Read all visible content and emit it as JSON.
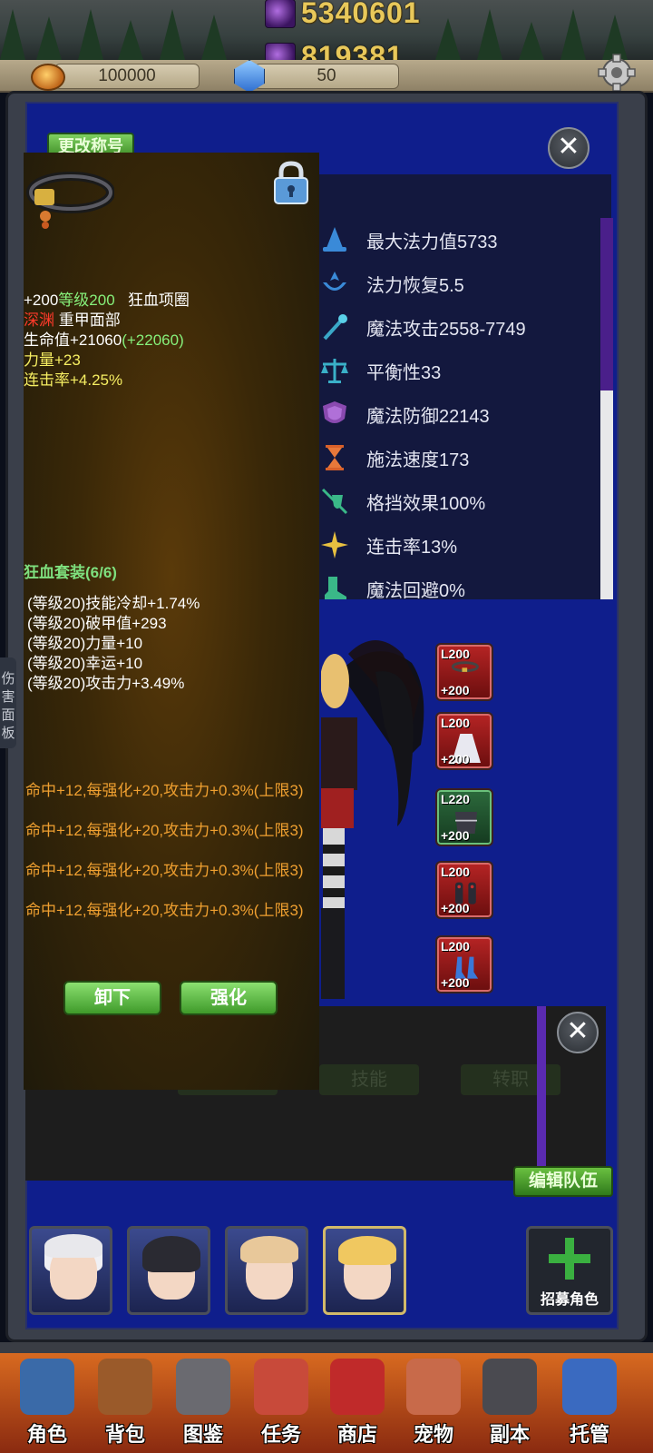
{
  "top": {
    "power_value": "5340601",
    "soul_value": "819381",
    "gold": "100000",
    "gems": "50"
  },
  "panel": {
    "rename_label": "更改称号",
    "close_symbol": "✕"
  },
  "stats": [
    {
      "icon": "wizard-hat-icon",
      "text": "最大法力值5733"
    },
    {
      "icon": "mana-regen-icon",
      "text": "法力恢复5.5"
    },
    {
      "icon": "wand-icon",
      "text": "魔法攻击2558-7749"
    },
    {
      "icon": "scales-icon",
      "text": "平衡性33"
    },
    {
      "icon": "shield-icon",
      "text": "魔法防御22143"
    },
    {
      "icon": "hourglass-icon",
      "text": "施法速度173"
    },
    {
      "icon": "block-icon",
      "text": "格挡效果100%"
    },
    {
      "icon": "combo-star-icon",
      "text": "连击率13%"
    },
    {
      "icon": "dodge-boot-icon",
      "text": "魔法回避0%"
    }
  ],
  "equipment": [
    {
      "level": "L200",
      "plus": "+200"
    },
    {
      "level": "L200",
      "plus": "+200"
    },
    {
      "level": "L220",
      "plus": "+200"
    },
    {
      "level": "L200",
      "plus": "+200"
    },
    {
      "level": "L200",
      "plus": "+200"
    }
  ],
  "side_tab": "伤害面板",
  "lower": {
    "ghost_left": "",
    "ghost_skill": "技能",
    "ghost_rebirth": "转职",
    "edit_team": "编辑队伍"
  },
  "recruit_label": "招募角色",
  "tooltip": {
    "enhance": "+200",
    "level_prefix": "等级",
    "level": "200",
    "item_name": "狂血项圈",
    "quality": "深渊",
    "slot": "重甲面部",
    "hp": "生命值+21060",
    "hp_bonus": "(+22060)",
    "strength": "力量+23",
    "combo": "连击率+4.25%",
    "set_title": "狂血套装(6/6)",
    "set_lines": [
      "(等级20)技能冷却+1.74%",
      "(等级20)破甲值+293",
      "(等级20)力量+10",
      "(等级20)幸运+10",
      "(等级20)攻击力+3.49%"
    ],
    "hit_lines": [
      "命中+12,每强化+20,攻击力+0.3%(上限3)",
      "命中+12,每强化+20,攻击力+0.3%(上限3)",
      "命中+12,每强化+20,攻击力+0.3%(上限3)",
      "命中+12,每强化+20,攻击力+0.3%(上限3)"
    ],
    "unequip": "卸下",
    "upgrade": "强化"
  },
  "nav": [
    {
      "label": "角色",
      "icon": "helmet-icon",
      "color": "#3a6aa8"
    },
    {
      "label": "背包",
      "icon": "backpack-icon",
      "color": "#9a5a2a"
    },
    {
      "label": "图鉴",
      "icon": "book-icon",
      "color": "#6a6a70"
    },
    {
      "label": "任务",
      "icon": "scroll-icon",
      "color": "#c84a3a"
    },
    {
      "label": "商店",
      "icon": "shop-icon",
      "color": "#c02a2a"
    },
    {
      "label": "宠物",
      "icon": "meat-icon",
      "color": "#c86a4a"
    },
    {
      "label": "副本",
      "icon": "skull-gate-icon",
      "color": "#4a4a50"
    },
    {
      "label": "托管",
      "icon": "calendar-icon",
      "color": "#3a6ac0"
    }
  ]
}
